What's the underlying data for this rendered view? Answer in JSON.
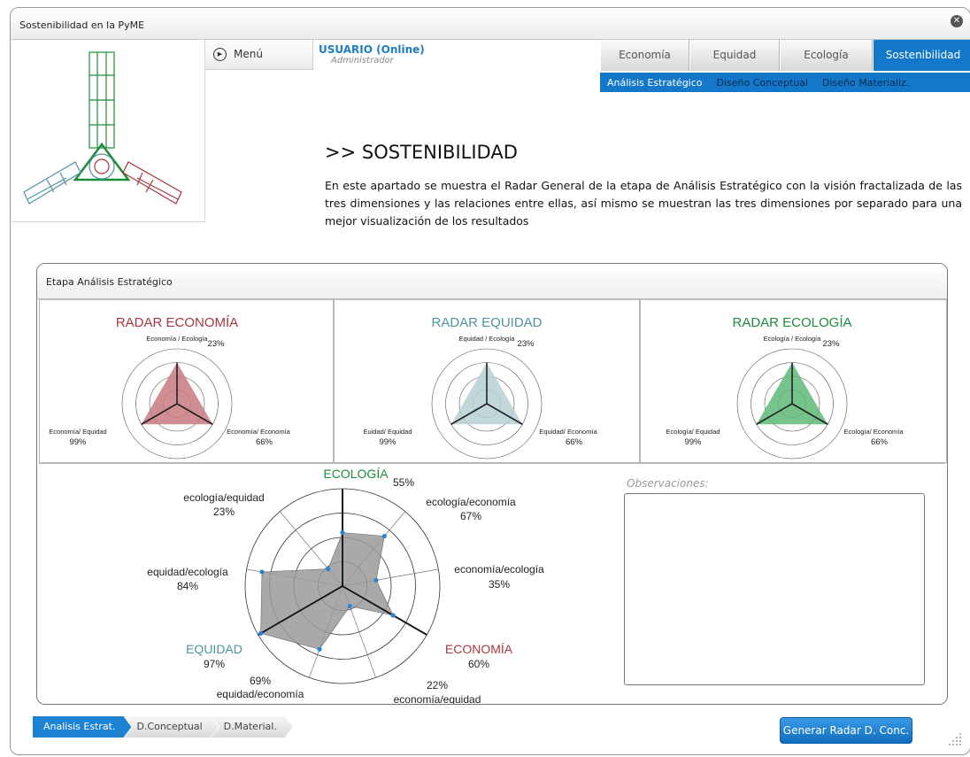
{
  "window": {
    "title": "Sostenibilidad en la PyME"
  },
  "menu": {
    "label": "Menú"
  },
  "user": {
    "name": "USUARIO (Online)",
    "role": "Administrador"
  },
  "tabs": [
    {
      "label": "Economía",
      "active": false
    },
    {
      "label": "Equidad",
      "active": false
    },
    {
      "label": "Ecología",
      "active": false
    },
    {
      "label": "Sostenibilidad",
      "active": true
    }
  ],
  "subtabs": [
    {
      "label": "Análisis Estratégico",
      "active": true
    },
    {
      "label": "Diseño Conceptual",
      "active": false
    },
    {
      "label": "Diseño Materializ.",
      "active": false
    }
  ],
  "main": {
    "heading": ">> SOSTENIBILIDAD",
    "intro": "En este apartado se muestra el Radar General de la etapa de Análisis Estratégico con la visión fractalizada de las tres dimensiones y las relaciones entre ellas, así mismo se muestran las tres dimensiones por separado para una mejor visualización de los resultados"
  },
  "panel": {
    "title": "Etapa Análisis Estratégico",
    "observations_label": "Observaciones:",
    "observations_value": ""
  },
  "colors": {
    "economia": "#a8363d",
    "equidad": "#4f93a3",
    "ecologia": "#1e8a3c",
    "accent": "#1378c9"
  },
  "chart_data": [
    {
      "type": "radar",
      "title": "RADAR ECONOMÍA",
      "color": "#a8363d",
      "fill": "#c77a7f",
      "axes": [
        {
          "label": "Economía / Ecología",
          "value_label": "23%",
          "value": 0.75
        },
        {
          "label": "Economía/ Economía",
          "value_label": "66%",
          "value": 0.75
        },
        {
          "label": "Economía/ Equidad",
          "value_label": "99%",
          "value": 0.75
        }
      ]
    },
    {
      "type": "radar",
      "title": "RADAR EQUIDAD",
      "color": "#4f93a3",
      "fill": "#b7d0d4",
      "axes": [
        {
          "label": "Equidad / Ecología",
          "value_label": "23%",
          "value": 0.75
        },
        {
          "label": "Equidad/ Economía",
          "value_label": "66%",
          "value": 0.75
        },
        {
          "label": "Euidad/ Equidad",
          "value_label": "99%",
          "value": 0.75
        }
      ]
    },
    {
      "type": "radar",
      "title": "RADAR ECOLOGÍA",
      "color": "#1e8a3c",
      "fill": "#5fb878",
      "axes": [
        {
          "label": "Ecología / Ecología",
          "value_label": "23%",
          "value": 0.75
        },
        {
          "label": "Ecología/ Economía",
          "value_label": "66%",
          "value": 0.75
        },
        {
          "label": "Ecología/ Equidad",
          "value_label": "99%",
          "value": 0.75
        }
      ]
    },
    {
      "type": "radar",
      "fill": "#9a9a9a",
      "axes": [
        {
          "label": "ECOLOGÍA",
          "value_label": "55%",
          "value": 55,
          "main": true,
          "color": "#1e8a3c"
        },
        {
          "label": "ecología/economía",
          "value_label": "67%",
          "value": 67
        },
        {
          "label": "economía/ecología",
          "value_label": "35%",
          "value": 35
        },
        {
          "label": "ECONOMÍA",
          "value_label": "60%",
          "value": 60,
          "main": true,
          "color": "#a8363d"
        },
        {
          "label": "economía/equidad",
          "value_label": "22%",
          "value": 22
        },
        {
          "label": "equidad/economía",
          "value_label": "69%",
          "value": 69
        },
        {
          "label": "EQUIDAD",
          "value_label": "97%",
          "value": 97,
          "main": true,
          "color": "#4f93a3"
        },
        {
          "label": "equidad/ecología",
          "value_label": "84%",
          "value": 84
        },
        {
          "label": "ecología/equidad",
          "value_label": "23%",
          "value": 23
        }
      ]
    }
  ],
  "stepper": [
    {
      "label": "Analisis Estrat.",
      "active": true
    },
    {
      "label": "D.Conceptual",
      "active": false
    },
    {
      "label": "D.Material.",
      "active": false
    }
  ],
  "actions": {
    "generate_label": "Generar Radar D. Conc."
  }
}
